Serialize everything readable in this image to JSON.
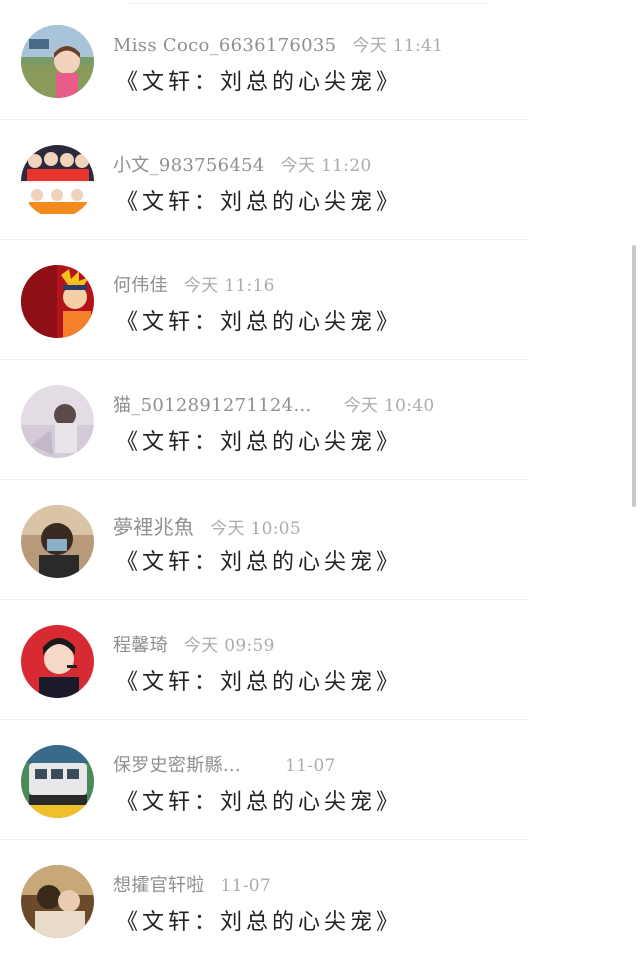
{
  "comments": [
    {
      "username": "Miss Coco_6636176035",
      "time": "今天 11:41",
      "text": "《文轩：刘总的心尖宠》",
      "avatar": "girl-park-photo-avatar"
    },
    {
      "username": "小文_983756454",
      "time": "今天 11:20",
      "text": "《文轩：刘总的心尖宠》",
      "avatar": "group-collage-avatar"
    },
    {
      "username": "何伟佳",
      "time": "今天 11:16",
      "text": "《文轩：刘总的心尖宠》",
      "avatar": "naruto-anime-avatar"
    },
    {
      "username": "猫_5012891271124…",
      "time": "今天 10:40",
      "text": "《文轩：刘总的心尖宠》",
      "avatar": "soft-girl-photo-avatar"
    },
    {
      "username": "夢裡兆魚",
      "time": "今天 10:05",
      "text": "《文轩：刘总的心尖宠》",
      "avatar": "masked-boy-photo-avatar"
    },
    {
      "username": "程馨琦",
      "time": "今天 09:59",
      "text": "《文轩：刘总的心尖宠》",
      "avatar": "singer-microphone-avatar"
    },
    {
      "username": "保罗史密斯縣…",
      "time": "11-07",
      "text": "《文轩：刘总的心尖宠》",
      "avatar": "subway-train-avatar"
    },
    {
      "username": "想攉官轩啦",
      "time": "11-07",
      "text": "《文轩：刘总的心尖宠》",
      "avatar": "couple-photo-avatar"
    }
  ],
  "colors": {
    "username": "#8f8f8f",
    "timestamp": "#ababab",
    "comment_text": "#222222",
    "divider": "#eeeeee",
    "scrollbar": "#c8c8c8"
  }
}
